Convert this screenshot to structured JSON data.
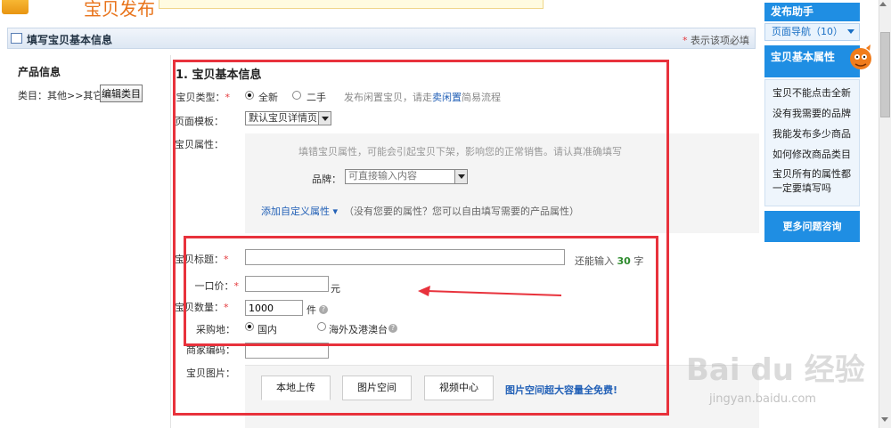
{
  "top": {
    "title": "宝贝发布"
  },
  "header": {
    "title": "填写宝贝基本信息",
    "required_star": "*",
    "required_note": "表示该项必填"
  },
  "left": {
    "title": "产品信息",
    "category_label": "类目：其他>>其它",
    "edit_category_button": "编辑类目"
  },
  "form": {
    "section_title": "1. 宝贝基本信息",
    "item_type": {
      "label": "宝贝类型：",
      "star": "*",
      "options": [
        "全新",
        "二手"
      ],
      "selected": "全新",
      "hint_prefix": "发布闲置宝贝，请走",
      "hint_link": "卖闲置",
      "hint_suffix": "简易流程"
    },
    "template": {
      "label": "页面模板：",
      "value": "默认宝贝详情页"
    },
    "attributes": {
      "label": "宝贝属性：",
      "hint": "填错宝贝属性，可能会引起宝贝下架，影响您的正常销售。请认真准确填写",
      "brand_label": "品牌：",
      "brand_placeholder": "可直接输入内容",
      "add_custom_link": "添加自定义属性",
      "add_custom_note": "（没有您要的属性？您可以自由填写需要的产品属性）"
    },
    "title_field": {
      "label": "宝贝标题：",
      "star": "*",
      "value": "",
      "remaining_prefix": "还能输入",
      "remaining_count": "30",
      "remaining_suffix": "字"
    },
    "price": {
      "label": "一口价：",
      "star": "*",
      "value": "",
      "unit": "元"
    },
    "quantity": {
      "label": "宝贝数量：",
      "star": "*",
      "value": "1000",
      "unit": "件"
    },
    "purchase": {
      "label": "采购地：",
      "options": [
        "国内",
        "海外及港澳台"
      ],
      "selected": "国内"
    },
    "merchant_code": {
      "label": "商家编码："
    },
    "images": {
      "label": "宝贝图片：",
      "tabs": [
        "本地上传",
        "图片空间",
        "视频中心"
      ],
      "active_tab": "本地上传",
      "promo_link": "图片空间超大容量全免费!"
    }
  },
  "sidebar": {
    "title": "发布助手",
    "nav": "页面导航（10）",
    "section": "宝贝基本属性",
    "items": [
      "宝贝不能点击全新",
      "没有我需要的品牌",
      "我能发布多少商品",
      "如何修改商品类目",
      "宝贝所有的属性都一定要填写吗"
    ],
    "more_button": "更多问题咨询"
  },
  "watermark": {
    "main": "Bai du 经验",
    "sub": "jingyan.baidu.com"
  },
  "colors": {
    "accent_blue": "#1f8ee3",
    "required_red": "#e4393c",
    "annotation_red": "#e8323c",
    "link_blue": "#2361b7",
    "count_green": "#2e8b2e"
  },
  "icons": [
    "edit-icon",
    "help-icon",
    "mascot-icon",
    "chevron-down-icon"
  ]
}
